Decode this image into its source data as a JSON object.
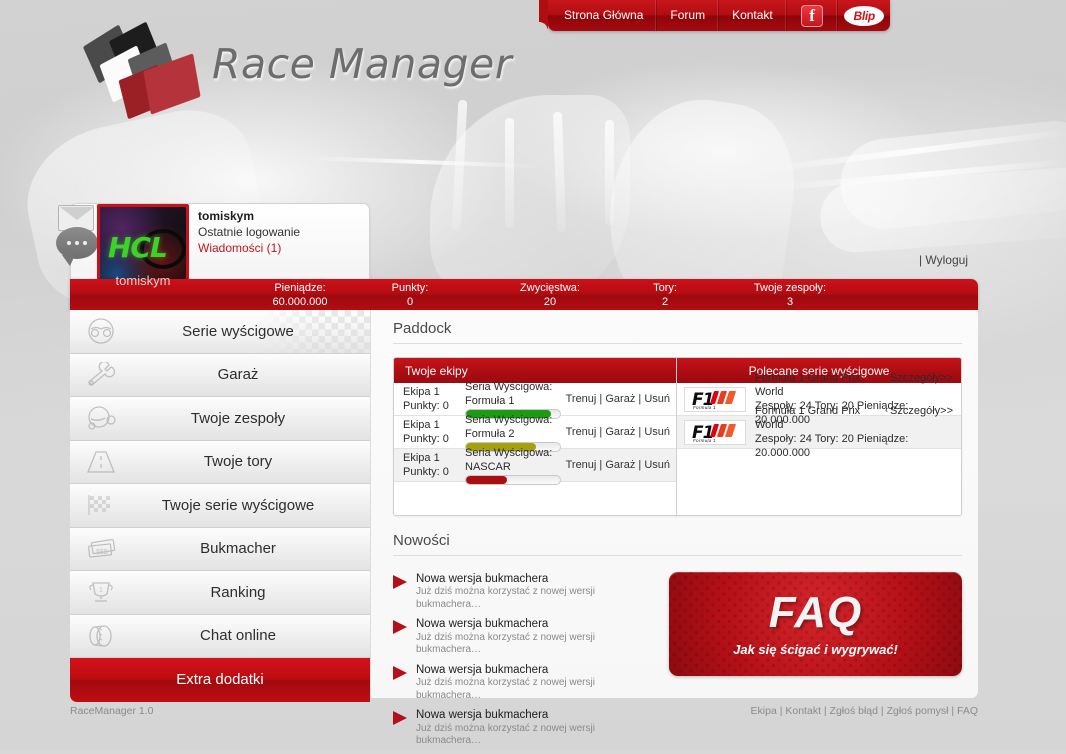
{
  "topnav": {
    "links": [
      "Strona Główna",
      "Forum",
      "Kontakt"
    ],
    "facebook_label": "f",
    "blip_label": "Blip"
  },
  "logo": {
    "text": "Race Manager"
  },
  "user": {
    "name": "tomiskym",
    "last_login": "Ostatnie logowanie",
    "messages": "Wiadomości (1)",
    "logout": "| Wyloguj",
    "avatar_text": "HCL",
    "avatar_name": "tomiskym"
  },
  "stats": [
    {
      "label": "Pieniądze:",
      "value": "60.000.000"
    },
    {
      "label": "Punkty:",
      "value": "0"
    },
    {
      "label": "Zwycięstwa:",
      "value": "20"
    },
    {
      "label": "Tory:",
      "value": "2"
    },
    {
      "label": "Twoje zespoły:",
      "value": "3"
    }
  ],
  "sidebar": {
    "items": [
      {
        "label": "Serie wyścigowe",
        "icon": "goggles-icon",
        "active": true
      },
      {
        "label": "Garaż",
        "icon": "wrench-icon",
        "active": false
      },
      {
        "label": "Twoje zespoły",
        "icon": "helmet-icon",
        "active": false
      },
      {
        "label": "Twoje tory",
        "icon": "road-icon",
        "active": false
      },
      {
        "label": "Twoje serie wyścigowe",
        "icon": "checkered-flag-icon",
        "active": false
      },
      {
        "label": "Bukmacher",
        "icon": "money-icon",
        "active": false
      },
      {
        "label": "Ranking",
        "icon": "trophy-icon",
        "active": false
      },
      {
        "label": "Chat online",
        "icon": "tire-icon",
        "active": false
      }
    ],
    "extra": {
      "label": "Extra dodatki",
      "icon": "extra-icon"
    }
  },
  "paddock": {
    "title": "Paddock",
    "headers": {
      "teams": "Twoje ekipy",
      "series": "Polecane serie wyścigowe"
    },
    "teams": [
      {
        "name": "Ekipa 1",
        "points": "Punkty: 0",
        "series": "Seria Wyścigowa: Formuła 1",
        "progress": 90,
        "color": "#1c9c12",
        "actions": [
          "Trenuj",
          "Garaż",
          "Usuń"
        ]
      },
      {
        "name": "Ekipa 1",
        "points": "Punkty: 0",
        "series": "Seria Wyścigowa: Formuła 2",
        "progress": 74,
        "color": "#a3a20c",
        "actions": [
          "Trenuj",
          "Garaż",
          "Usuń"
        ]
      },
      {
        "name": "Ekipa 1",
        "points": "Punkty: 0",
        "series": "Seria Wyścigowa: NASCAR",
        "progress": 44,
        "color": "#a80f12",
        "actions": [
          "Trenuj",
          "Garaż",
          "Usuń"
        ]
      }
    ],
    "series": [
      {
        "logo_text": "F1",
        "logo_sub": "Formula 1",
        "name": "Formuła 1 Grand Prix World",
        "details": "Szczegóły>>",
        "stats": "Zespoły: 24 Tory: 20 Pieniądze: 20.000.000"
      },
      {
        "logo_text": "F1",
        "logo_sub": "Formula 1",
        "name": "Formuła 1 Grand Prix World",
        "details": "Szczegóły>>",
        "stats": "Zespoły: 24 Tory: 20 Pieniądze: 20.000.000"
      }
    ]
  },
  "news": {
    "title": "Nowości",
    "items": [
      {
        "title": "Nowa wersja bukmachera",
        "desc": "Już dziś można korzystać z nowej wersji bukmachera…"
      },
      {
        "title": "Nowa wersja bukmachera",
        "desc": "Już dziś można korzystać z nowej wersji bukmachera…"
      },
      {
        "title": "Nowa wersja bukmachera",
        "desc": "Już dziś można korzystać z nowej wersji bukmachera…"
      },
      {
        "title": "Nowa wersja bukmachera",
        "desc": "Już dziś można korzystać z nowej wersji bukmachera…"
      }
    ]
  },
  "faq": {
    "title": "FAQ",
    "subtitle": "Jak się ścigać i wygrywać!"
  },
  "footer": {
    "version": "RaceManager 1.0",
    "links": [
      "Ekipa",
      "Kontakt",
      "Zgłoś błąd",
      "Zgłoś pomysł",
      "FAQ"
    ]
  },
  "colors": {
    "brand_red": "#b60c12",
    "accent": "#cc1017"
  }
}
